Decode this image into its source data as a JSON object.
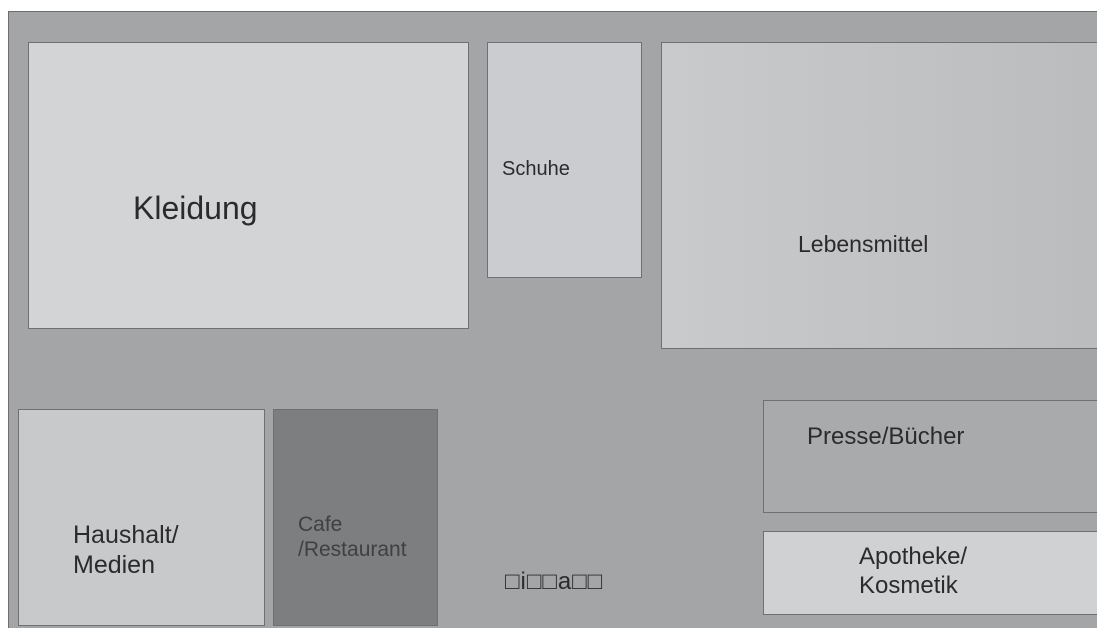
{
  "shops": {
    "kleidung": "Kleidung",
    "schuhe": "Schuhe",
    "lebensmittel": "Lebensmittel",
    "haushalt": "Haushalt/\nMedien",
    "cafe": "Cafe\n/Restaurant",
    "presse": "Presse/Bücher",
    "apotheke": "Apotheke/\nKosmetik"
  },
  "symbols_text": "□i□□a□□",
  "colors": {
    "floor": "#a4a5a7",
    "cafe": "#7d7e80",
    "light_shop": "#d3d4d6"
  }
}
